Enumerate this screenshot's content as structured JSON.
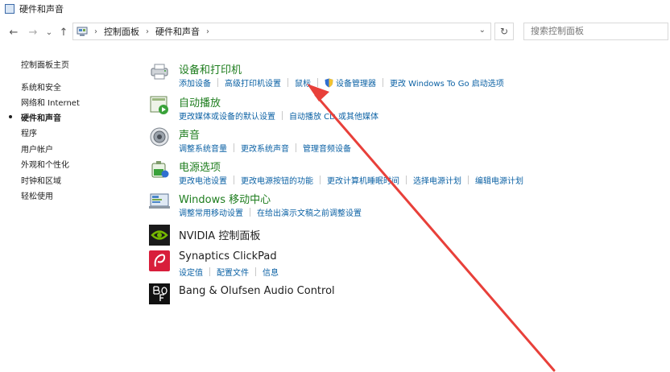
{
  "window": {
    "title": "硬件和声音"
  },
  "nav": {
    "back": "←",
    "forward": "→",
    "recent": "⌄",
    "up": "↑",
    "breadcrumbs": [
      "控制面板",
      "硬件和声音"
    ],
    "dropdown": "⌄",
    "refresh": "↻",
    "search_placeholder": "搜索控制面板"
  },
  "sidebar": {
    "home": "控制面板主页",
    "items": [
      "系统和安全",
      "网络和 Internet",
      "硬件和声音",
      "程序",
      "用户帐户",
      "外观和个性化",
      "时钟和区域",
      "轻松使用"
    ],
    "current_index": 2
  },
  "categories": [
    {
      "title": "设备和打印机",
      "icon": "printer-icon",
      "links": [
        "添加设备",
        "高级打印机设置",
        "鼠标",
        "设备管理器",
        "更改 Windows To Go 启动选项"
      ]
    },
    {
      "title": "自动播放",
      "icon": "autoplay-icon",
      "links": [
        "更改媒体或设备的默认设置",
        "自动播放 CD 或其他媒体"
      ]
    },
    {
      "title": "声音",
      "icon": "speaker-icon",
      "links": [
        "调整系统音量",
        "更改系统声音",
        "管理音频设备"
      ]
    },
    {
      "title": "电源选项",
      "icon": "battery-icon",
      "links": [
        "更改电池设置",
        "更改电源按钮的功能",
        "更改计算机睡眠时间",
        "选择电源计划",
        "编辑电源计划"
      ]
    },
    {
      "title": "Windows 移动中心",
      "icon": "mobility-center-icon",
      "links": [
        "调整常用移动设置",
        "在给出演示文稿之前调整设置"
      ]
    },
    {
      "title": "NVIDIA 控制面板",
      "icon": "nvidia-icon",
      "links": []
    },
    {
      "title": "Synaptics ClickPad",
      "icon": "synaptics-icon",
      "links": [
        "设定值",
        "配置文件",
        "信息"
      ]
    },
    {
      "title": "Bang & Olufsen Audio Control",
      "icon": "bang-olufsen-icon",
      "links": []
    }
  ],
  "annotation": {
    "color": "#e8403a"
  }
}
